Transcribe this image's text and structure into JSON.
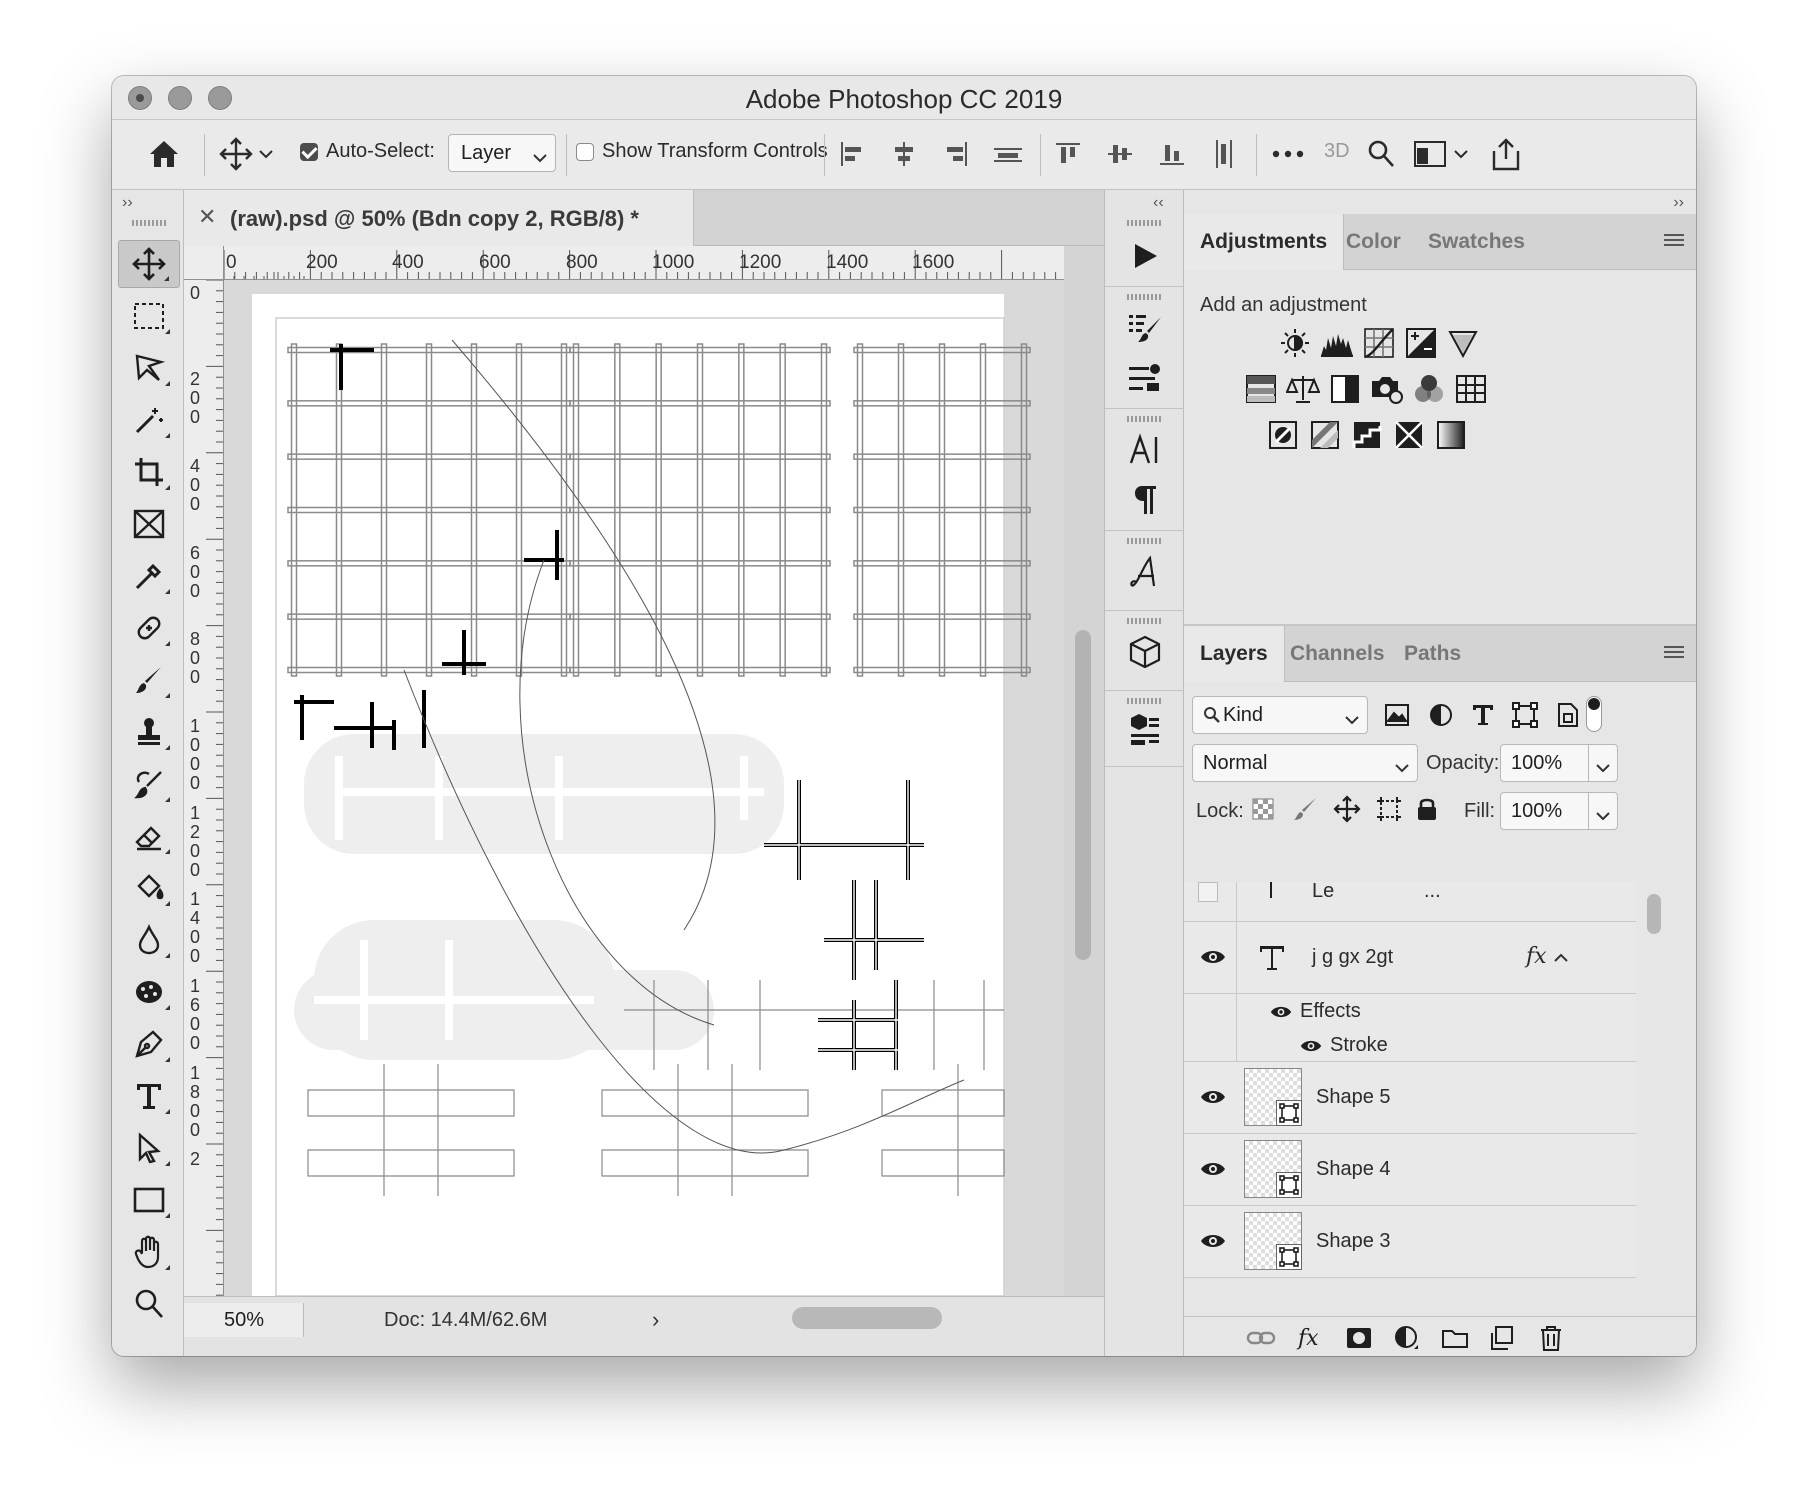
{
  "window": {
    "title": "Adobe Photoshop CC 2019"
  },
  "options_bar": {
    "auto_select_label": "Auto-Select:",
    "auto_select_checked": true,
    "auto_select_target": "Layer",
    "show_transform_label": "Show Transform Controls",
    "show_transform_checked": false,
    "three_d_label": "3D"
  },
  "document": {
    "tab_title": "(raw).psd @ 50% (Bdn copy 2, RGB/8) *",
    "zoom": "50%",
    "doc_info": "Doc: 14.4M/62.6M",
    "ruler_h": [
      "0",
      "200",
      "400",
      "600",
      "800",
      "1000",
      "1200",
      "1400",
      "1600"
    ],
    "ruler_v": [
      "0",
      "200",
      "400",
      "600",
      "800",
      "1000",
      "1200",
      "1400",
      "1600",
      "1800",
      "2"
    ]
  },
  "adjustments": {
    "tabs": [
      "Adjustments",
      "Color",
      "Swatches"
    ],
    "active_tab": "Adjustments",
    "hint": "Add an adjustment"
  },
  "layers": {
    "tabs": [
      "Layers",
      "Channels",
      "Paths"
    ],
    "active_tab": "Layers",
    "filter_kind": "Kind",
    "blend_mode": "Normal",
    "opacity_label": "Opacity:",
    "opacity": "100%",
    "lock_label": "Lock:",
    "fill_label": "Fill:",
    "fill": "100%",
    "items": [
      {
        "name": "Le",
        "type": "text",
        "visible": false,
        "extra": "..."
      },
      {
        "name": "j g gx 2gt",
        "type": "text",
        "visible": true,
        "fx": "fx"
      },
      {
        "name": "Effects",
        "type": "effects",
        "visible": true
      },
      {
        "name": "Stroke",
        "type": "effect",
        "visible": true
      },
      {
        "name": "Shape 5",
        "type": "shape",
        "visible": true
      },
      {
        "name": "Shape 4",
        "type": "shape",
        "visible": true
      },
      {
        "name": "Shape 3",
        "type": "shape",
        "visible": true
      }
    ]
  },
  "colors": {
    "active_tool_bg": "#c9c9c9",
    "panel_bg": "#e6e6e6",
    "window_bg": "#d7d7d7"
  }
}
